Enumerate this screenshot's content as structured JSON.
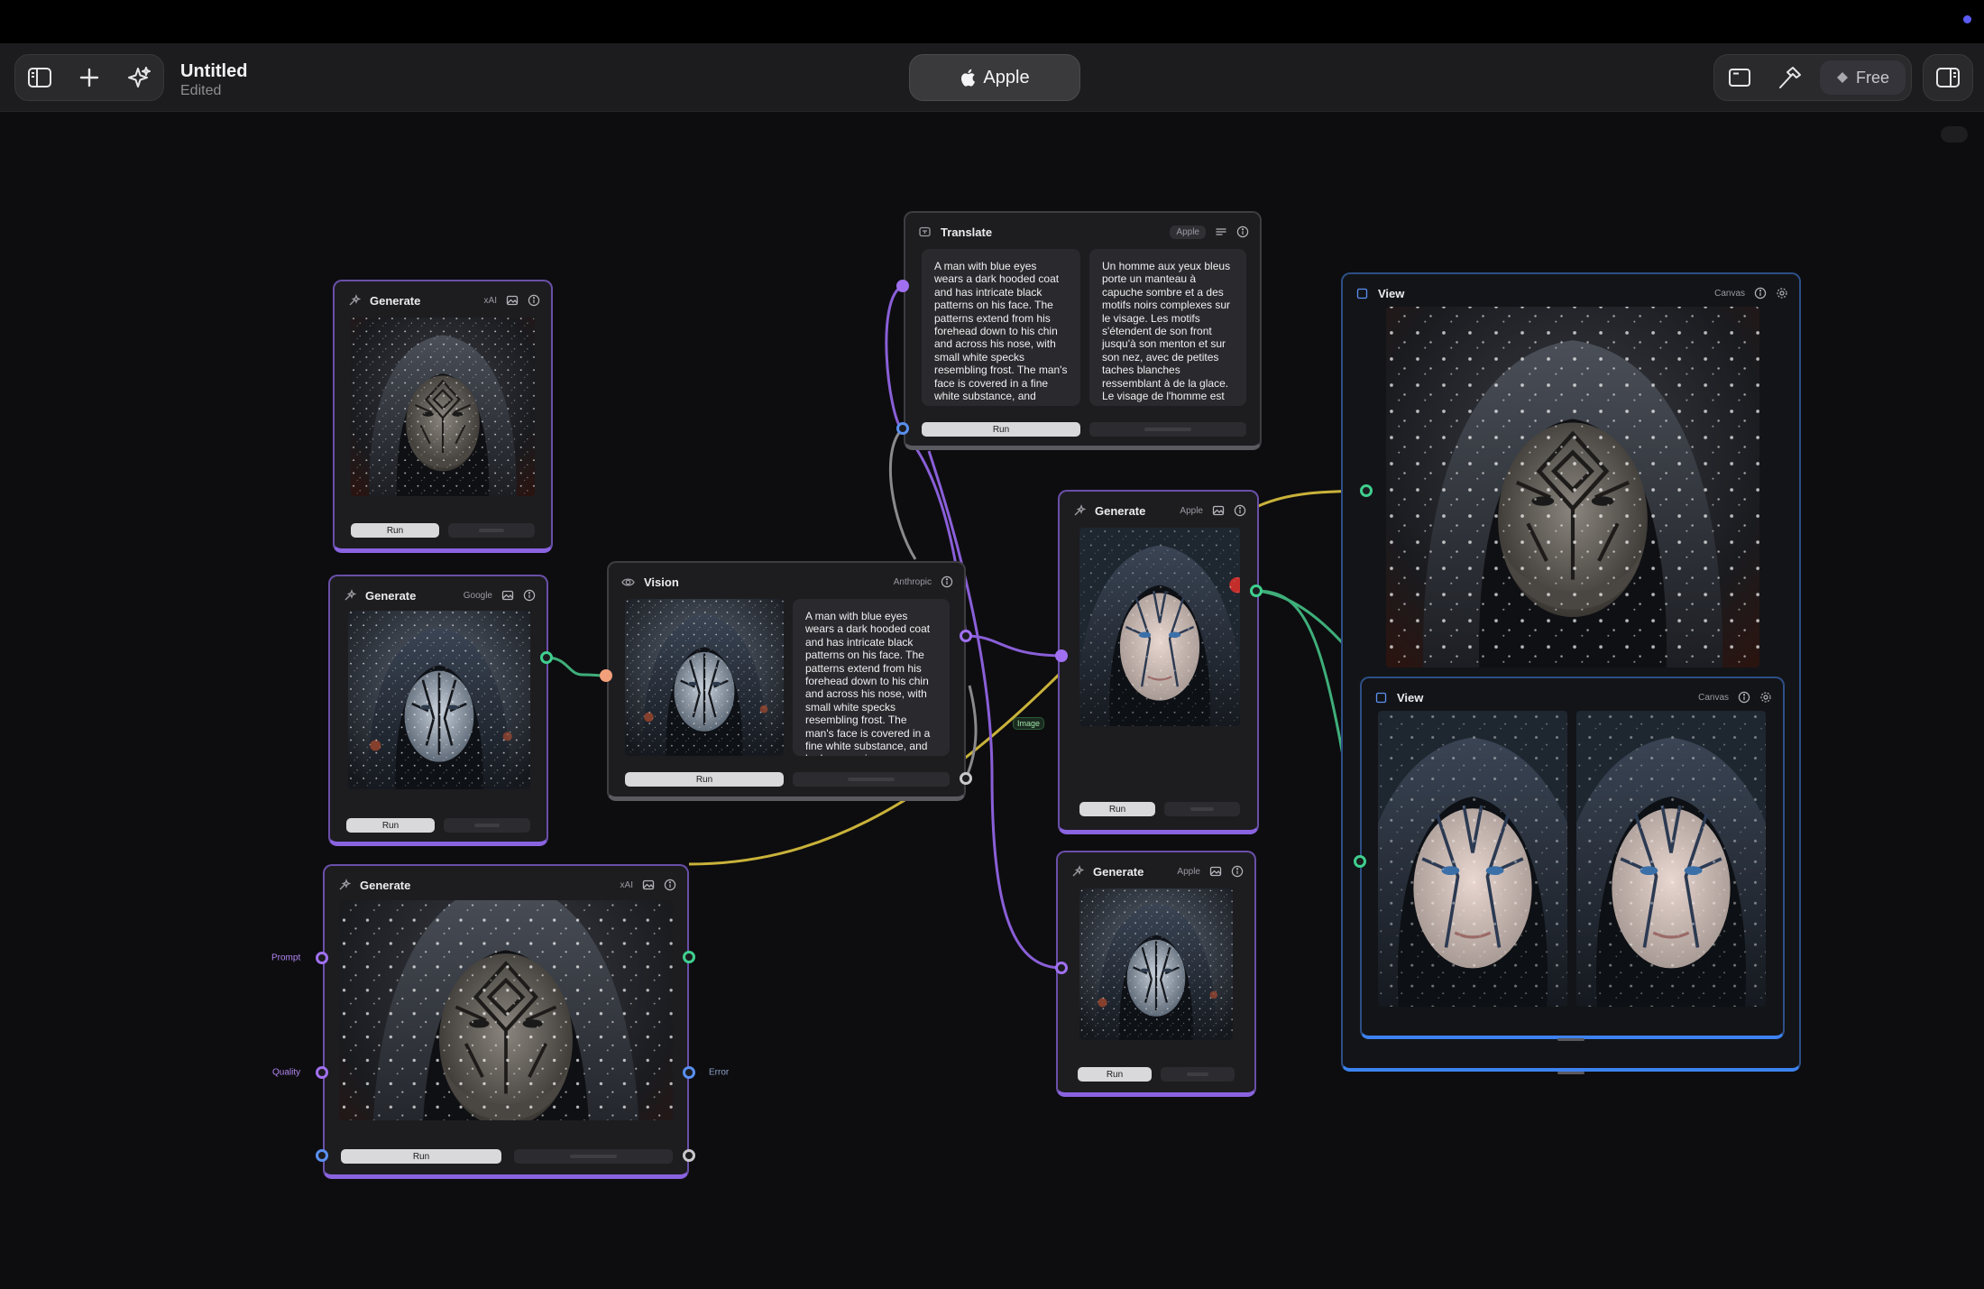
{
  "toolbar": {
    "doc_title": "Untitled",
    "doc_status": "Edited",
    "model_label": "Apple",
    "plan_label": "Free"
  },
  "nodes": {
    "gen1": {
      "title": "Generate",
      "provider": "xAI",
      "run": "Run"
    },
    "gen2": {
      "title": "Generate",
      "provider": "Google",
      "run": "Run"
    },
    "gen3": {
      "title": "Generate",
      "provider": "xAI",
      "run": "Run",
      "port_prompt": "Prompt",
      "port_quality": "Quality",
      "port_error": "Error"
    },
    "vision": {
      "title": "Vision",
      "provider": "Anthropic",
      "run": "Run",
      "output": "A man with blue eyes wears a dark hooded coat and has intricate black patterns on his face. The patterns extend from his forehead down to his chin and across his nose, with small white specks resembling frost. The man's face is covered in a fine white substance, and he has a serious"
    },
    "translate": {
      "title": "Translate",
      "provider": "Apple",
      "run": "Run",
      "input": "A man with blue eyes wears a dark hooded coat and has intricate black patterns on his face. The patterns extend from his forehead down to his chin and across his nose, with small white specks resembling frost. The man's face is covered in a fine white substance, and",
      "output": "Un homme aux yeux bleus porte un manteau à capuche sombre et a des motifs noirs complexes sur le visage. Les motifs s'étendent de son front jusqu'à son menton et sur son nez, avec de petites taches blanches ressemblant à de la glace. Le visage de l'homme est"
    },
    "gen4": {
      "title": "Generate",
      "provider": "Apple",
      "run": "Run"
    },
    "gen5": {
      "title": "Generate",
      "provider": "Apple",
      "run": "Run"
    },
    "view1": {
      "title": "View",
      "provider": "Canvas"
    },
    "view2": {
      "title": "View",
      "provider": "Canvas"
    }
  },
  "edge_label": "Image",
  "colors": {
    "accent_purple": "#8a63e0",
    "wire_yellow": "#c9b23a",
    "wire_green": "#3fae7a",
    "wire_purple": "#8a5fd8",
    "wire_grey": "#8a8a8e",
    "view_blue": "#3d82f0"
  }
}
